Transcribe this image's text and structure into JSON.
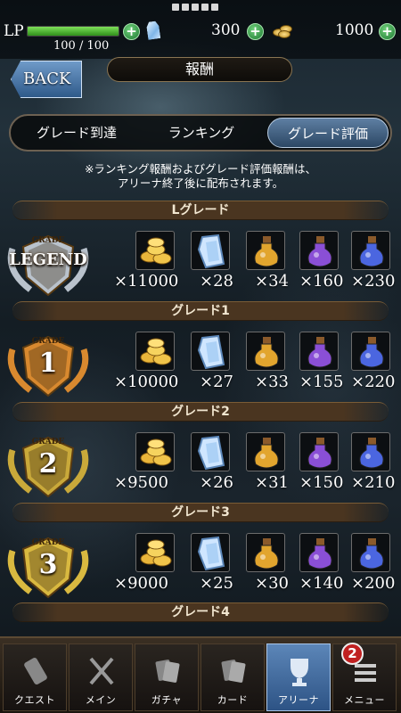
{
  "status": {
    "lp_label": "LP",
    "lp_value": "100 / 100",
    "lp_fraction": 1.0,
    "gems": "300",
    "coins": "1000",
    "plus": "+"
  },
  "header": {
    "back_label": "BACK",
    "title": "報酬"
  },
  "tabs": [
    {
      "label": "グレード到達"
    },
    {
      "label": "ランキング"
    },
    {
      "label": "グレード評価",
      "active": true
    }
  ],
  "note": {
    "line1": "※ランキング報酬およびグレード評価報酬は、",
    "line2": "アリーナ終了後に配布されます。"
  },
  "grades": [
    {
      "title": "Lグレード",
      "badge_top": "GRADE",
      "badge_main": "LEGEND",
      "rewards": [
        "×11000",
        "×28",
        "×34",
        "×160",
        "×230"
      ]
    },
    {
      "title": "グレード1",
      "badge_top": "GRADE",
      "badge_main": "1",
      "rewards": [
        "×10000",
        "×27",
        "×33",
        "×155",
        "×220"
      ]
    },
    {
      "title": "グレード2",
      "badge_top": "GRADE",
      "badge_main": "2",
      "rewards": [
        "×9500",
        "×26",
        "×31",
        "×150",
        "×210"
      ]
    },
    {
      "title": "グレード3",
      "badge_top": "GRADE",
      "badge_main": "3",
      "rewards": [
        "×9000",
        "×25",
        "×30",
        "×140",
        "×200"
      ]
    },
    {
      "title": "グレード4"
    }
  ],
  "nav": [
    {
      "label": "クエスト"
    },
    {
      "label": "メイン"
    },
    {
      "label": "ガチャ"
    },
    {
      "label": "カード"
    },
    {
      "label": "アリーナ",
      "active": true
    },
    {
      "label": "メニュー"
    }
  ],
  "menu_badge": "2",
  "colors": {
    "gold": "#f2c445",
    "accent_blue": "#3d6a9e",
    "band": "#4a3520"
  }
}
